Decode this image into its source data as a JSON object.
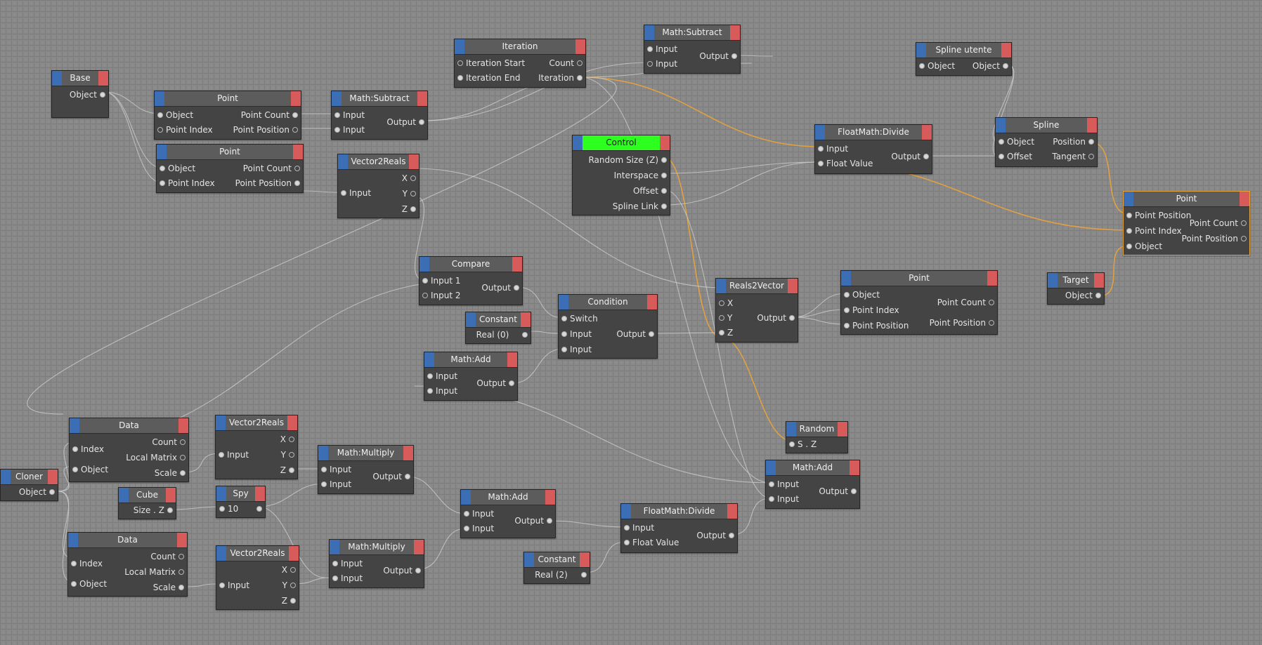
{
  "colors": {
    "canvas": "#8a8a8a",
    "node_body": "#444444",
    "node_title": "#5c5c5c",
    "in_tab": "#3b6eb5",
    "out_tab": "#d85b5b",
    "control_title": "#2dff1e",
    "wire": "#cfcfcf",
    "wire_selected": "#e6a23c"
  },
  "nodes": {
    "base": {
      "title": "Base",
      "out": [
        "Object"
      ]
    },
    "point1": {
      "title": "Point",
      "in": [
        "Object",
        "Point Index"
      ],
      "out": [
        "Point Count",
        "Point Position"
      ]
    },
    "point2": {
      "title": "Point",
      "in": [
        "Object",
        "Point Index"
      ],
      "out": [
        "Point Count",
        "Point Position"
      ]
    },
    "mathsub1": {
      "title": "Math:Subtract",
      "in": [
        "Input",
        "Input"
      ],
      "out": [
        "Output"
      ]
    },
    "iteration": {
      "title": "Iteration",
      "in": [
        "Iteration Start",
        "Iteration End"
      ],
      "out": [
        "Count",
        "Iteration"
      ]
    },
    "mathsub2": {
      "title": "Math:Subtract",
      "in": [
        "Input",
        "Input"
      ],
      "out": [
        "Output"
      ]
    },
    "splineutente": {
      "title": "Spline  utente",
      "in": [
        "Object"
      ],
      "out": [
        "Object"
      ]
    },
    "vector2reals1": {
      "title": "Vector2Reals",
      "in": [
        "Input"
      ],
      "out": [
        "X",
        "Y",
        "Z"
      ]
    },
    "control": {
      "title": "Control",
      "out": [
        "Random Size (Z)",
        "Interspace",
        "Offset",
        "Spline Link"
      ]
    },
    "floatdivide1": {
      "title": "FloatMath:Divide",
      "in": [
        "Input",
        "Float Value"
      ],
      "out": [
        "Output"
      ]
    },
    "spline": {
      "title": "Spline",
      "in": [
        "Object",
        "Offset"
      ],
      "out": [
        "Position",
        "Tangent"
      ]
    },
    "point3": {
      "title": "Point",
      "in": [
        "Point Position",
        "Point Index",
        "Object"
      ],
      "out": [
        "Point Count",
        "Point Position"
      ]
    },
    "compare": {
      "title": "Compare",
      "in": [
        "Input 1",
        "Input 2"
      ],
      "out": [
        "Output"
      ]
    },
    "constant1": {
      "title": "Constant",
      "out": [
        "Real (0)"
      ]
    },
    "condition": {
      "title": "Condition",
      "in": [
        "Switch",
        "Input",
        "Input"
      ],
      "out": [
        "Output"
      ]
    },
    "reals2vector": {
      "title": "Reals2Vector",
      "in": [
        "X",
        "Y",
        "Z"
      ],
      "out": [
        "Output"
      ]
    },
    "point4": {
      "title": "Point",
      "in": [
        "Object",
        "Point Index",
        "Point Position"
      ],
      "out": [
        "Point Count",
        "Point Position"
      ]
    },
    "target": {
      "title": "Target",
      "out": [
        "Object"
      ]
    },
    "mathadd1": {
      "title": "Math:Add",
      "in": [
        "Input",
        "Input"
      ],
      "out": [
        "Output"
      ]
    },
    "random": {
      "title": "Random",
      "out": [
        "S . Z"
      ]
    },
    "data1": {
      "title": "Data",
      "in": [
        "Index",
        "Object"
      ],
      "out": [
        "Count",
        "Local Matrix",
        "Scale"
      ]
    },
    "vector2reals2": {
      "title": "Vector2Reals",
      "in": [
        "Input"
      ],
      "out": [
        "X",
        "Y",
        "Z"
      ]
    },
    "cloner": {
      "title": "Cloner",
      "out": [
        "Object"
      ]
    },
    "mathmul1": {
      "title": "Math:Multiply",
      "in": [
        "Input",
        "Input"
      ],
      "out": [
        "Output"
      ]
    },
    "cube": {
      "title": "Cube",
      "out": [
        "Size . Z"
      ]
    },
    "spy": {
      "title": "Spy",
      "out": [
        "10"
      ]
    },
    "mathadd2": {
      "title": "Math:Add",
      "in": [
        "Input",
        "Input"
      ],
      "out": [
        "Output"
      ]
    },
    "floatdivide2": {
      "title": "FloatMath:Divide",
      "in": [
        "Input",
        "Float Value"
      ],
      "out": [
        "Output"
      ]
    },
    "mathadd3": {
      "title": "Math:Add",
      "in": [
        "Input",
        "Input"
      ],
      "out": [
        "Output"
      ]
    },
    "data2": {
      "title": "Data",
      "in": [
        "Index",
        "Object"
      ],
      "out": [
        "Count",
        "Local Matrix",
        "Scale"
      ]
    },
    "vector2reals3": {
      "title": "Vector2Reals",
      "in": [
        "Input"
      ],
      "out": [
        "X",
        "Y",
        "Z"
      ]
    },
    "mathmul2": {
      "title": "Math:Multiply",
      "in": [
        "Input",
        "Input"
      ],
      "out": [
        "Output"
      ]
    },
    "constant2": {
      "title": "Constant",
      "out": [
        "Real (2)"
      ]
    }
  }
}
